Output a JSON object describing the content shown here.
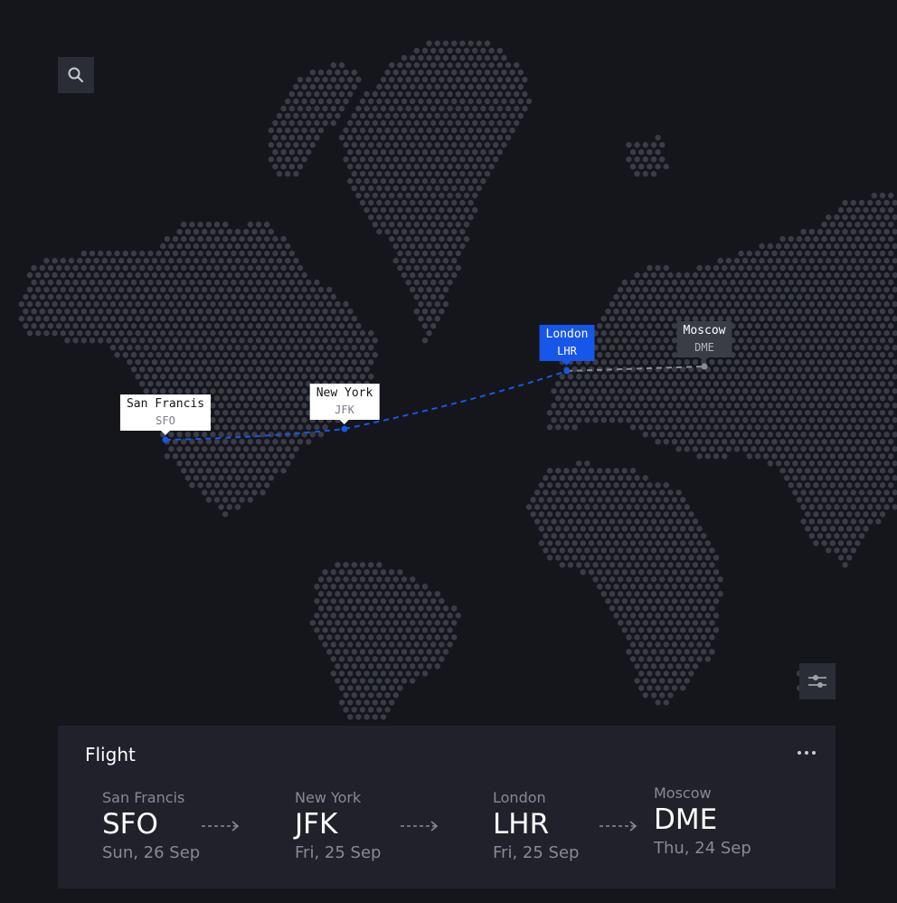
{
  "map": {
    "dot_color": "#3a3c47",
    "background": "#15161b",
    "route_color": "#1656e8",
    "route_pending_color": "#8a8d98"
  },
  "toolbar": {
    "search_icon": "search-icon",
    "filter_icon": "sliders-icon"
  },
  "markers": [
    {
      "city": "San Francis",
      "code": "SFO",
      "style": "white"
    },
    {
      "city": "New York",
      "code": "JFK",
      "style": "white"
    },
    {
      "city": "London",
      "code": "LHR",
      "style": "active"
    },
    {
      "city": "Moscow",
      "code": "DME",
      "style": "pending"
    }
  ],
  "panel": {
    "title": "Flight",
    "menu_icon": "more-dots-icon",
    "stops": [
      {
        "city": "San Francis",
        "code": "SFO",
        "date": "Sun, 26 Sep"
      },
      {
        "city": "New York",
        "code": "JFK",
        "date": "Fri, 25 Sep"
      },
      {
        "city": "London",
        "code": "LHR",
        "date": "Fri, 25 Sep"
      },
      {
        "city": "Moscow",
        "code": "DME",
        "date": "Thu, 24 Sep"
      }
    ]
  }
}
